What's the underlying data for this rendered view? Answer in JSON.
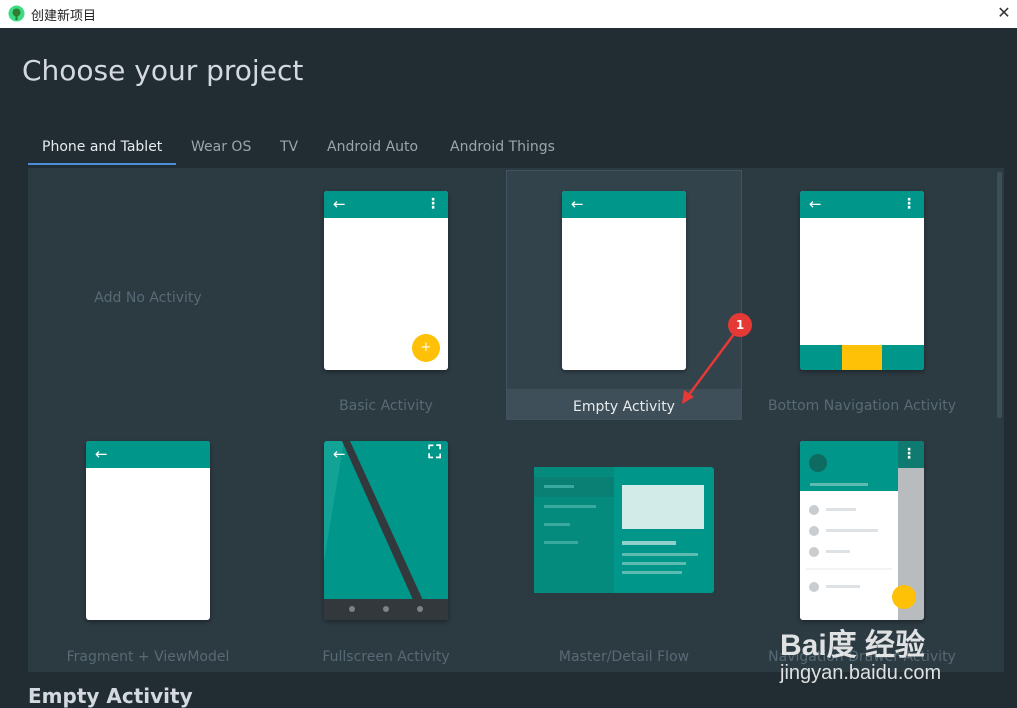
{
  "window": {
    "title": "创建新项目",
    "close_glyph": "✕"
  },
  "page": {
    "heading": "Choose your project",
    "footer_title": "Empty Activity"
  },
  "tabs": [
    {
      "label": "Phone and Tablet",
      "active": true
    },
    {
      "label": "Wear OS",
      "active": false
    },
    {
      "label": "TV",
      "active": false
    },
    {
      "label": "Android Auto",
      "active": false
    },
    {
      "label": "Android Things",
      "active": false
    }
  ],
  "templates": [
    {
      "label": "Add No Activity"
    },
    {
      "label": "Basic Activity",
      "fab_glyph": "+"
    },
    {
      "label": "Empty Activity",
      "selected": true
    },
    {
      "label": "Bottom Navigation Activity"
    },
    {
      "label": "Fragment + ViewModel"
    },
    {
      "label": "Fullscreen Activity"
    },
    {
      "label": "Master/Detail Flow"
    },
    {
      "label": "Navigation Drawer Activity"
    }
  ],
  "icons": {
    "back": "←",
    "menu": "⋮",
    "fullscreen": "⛶"
  },
  "annotation": {
    "badge": "1"
  },
  "watermark": {
    "logo": "Bai度 经验",
    "url": "jingyan.baidu.com"
  },
  "colors": {
    "teal": "#00968a",
    "accent_yellow": "#ffc107",
    "tab_underline": "#4a8fd6",
    "badge_red": "#e53935"
  }
}
